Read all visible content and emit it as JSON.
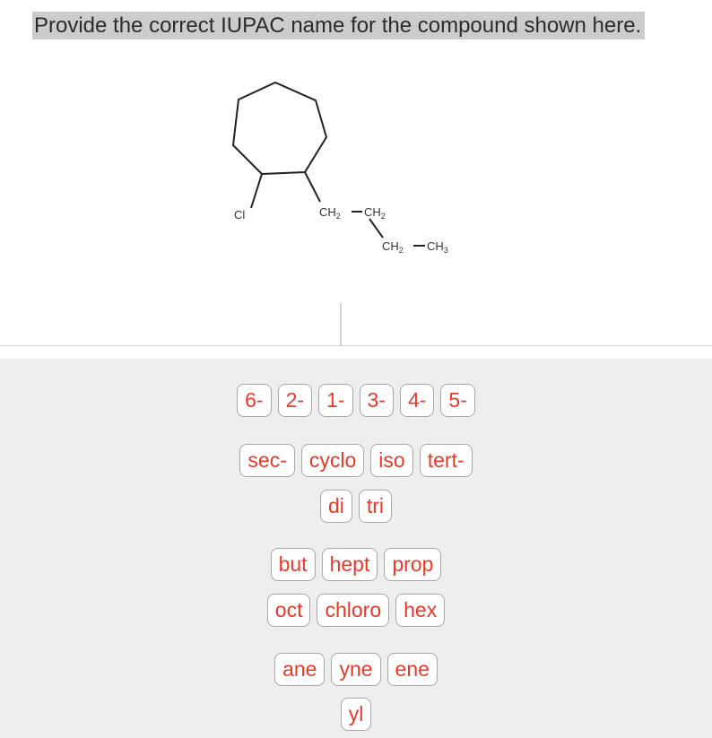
{
  "prompt": "Provide the correct IUPAC name for the compound shown here.",
  "structure": {
    "substituent_label": "Cl",
    "chain": [
      {
        "main": "CH",
        "sub": "2"
      },
      {
        "main": "CH",
        "sub": "2"
      },
      {
        "main": "CH",
        "sub": "2"
      },
      {
        "main": "CH",
        "sub": "3"
      }
    ]
  },
  "palette": {
    "locants": [
      "6-",
      "2-",
      "1-",
      "3-",
      "4-",
      "5-"
    ],
    "prefixes": [
      "sec-",
      "cyclo",
      "iso",
      "tert-"
    ],
    "multipliers": [
      "di",
      "tri"
    ],
    "roots_row1": [
      "but",
      "hept",
      "prop"
    ],
    "roots_row2": [
      "oct",
      "chloro",
      "hex"
    ],
    "suffixes": [
      "ane",
      "yne",
      "ene"
    ],
    "suffixes_row2": [
      "yl"
    ]
  },
  "colors": {
    "button_text": "#e8392a",
    "palette_bg": "#eeeeee",
    "prompt_bg": "#cccccc"
  }
}
